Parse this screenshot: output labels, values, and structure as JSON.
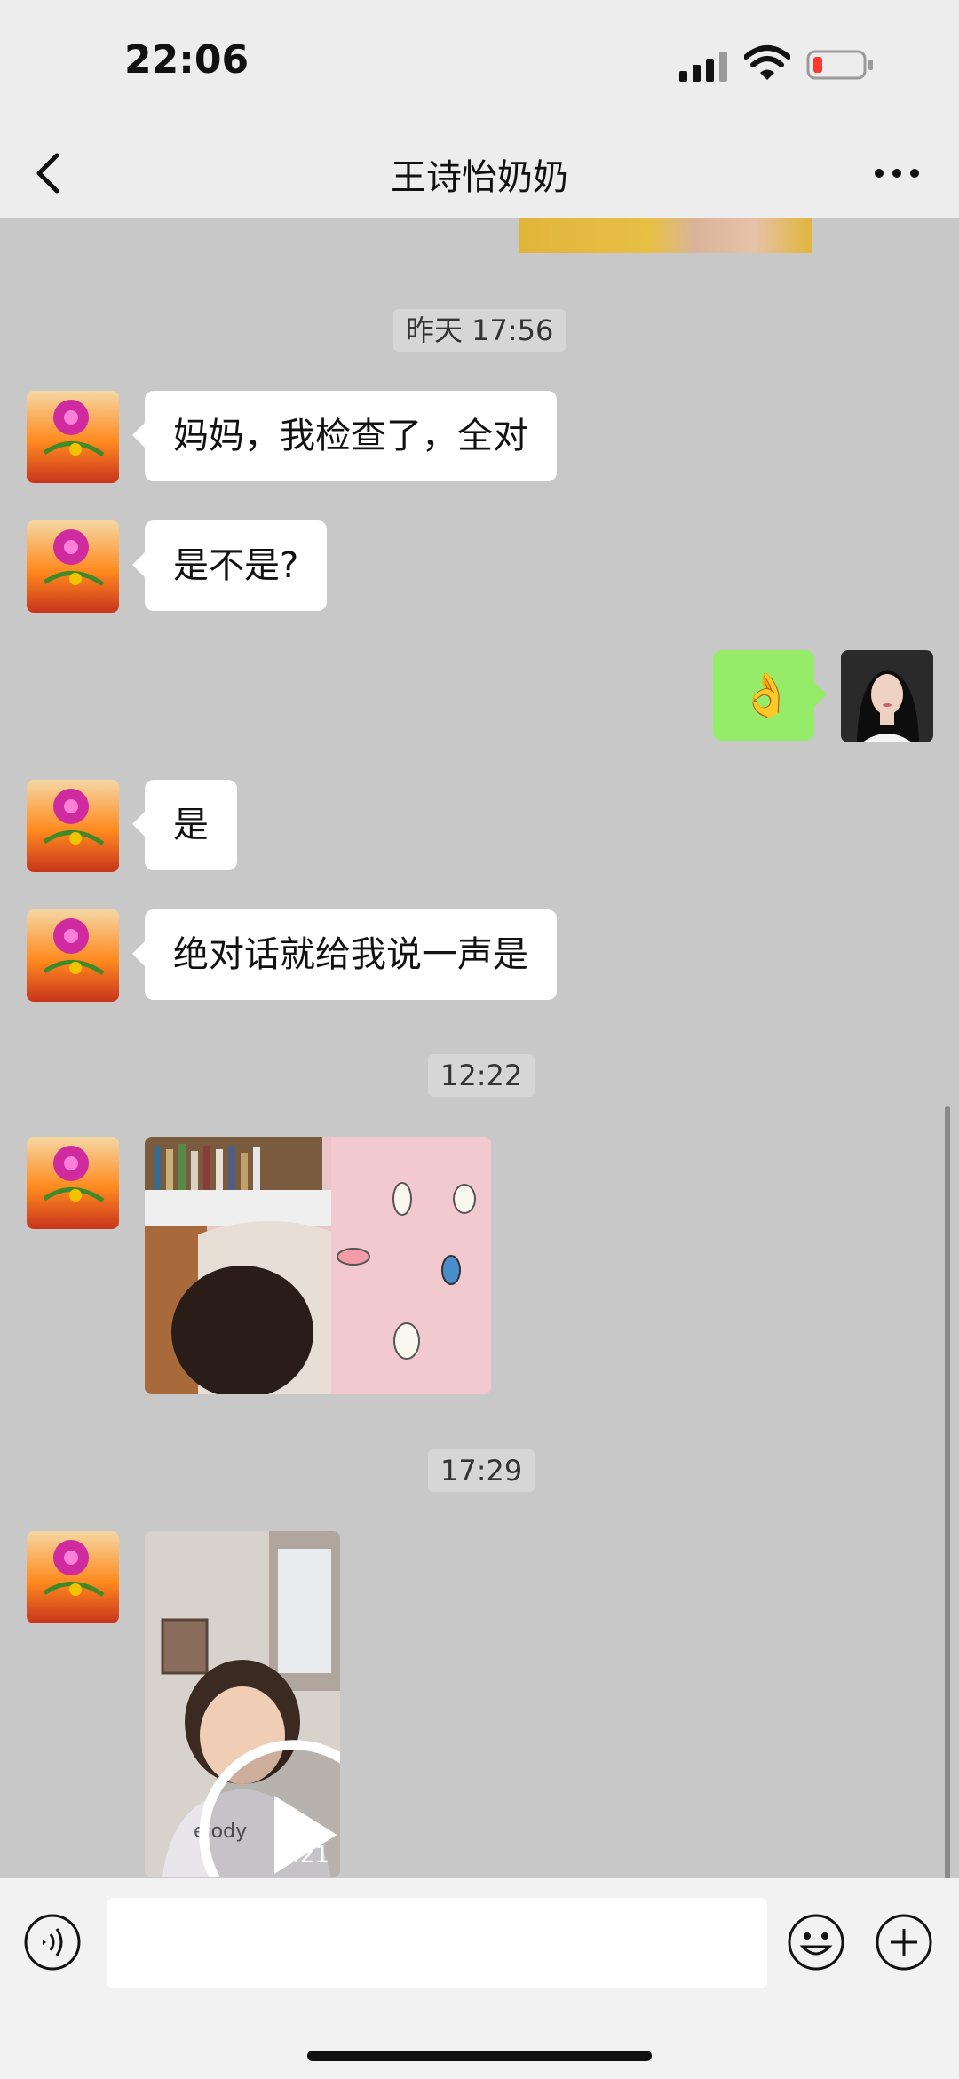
{
  "status_bar": {
    "time": "22:06",
    "signal_icon": "signal-bars-icon",
    "wifi_icon": "wifi-icon",
    "battery_icon": "battery-low-icon",
    "battery_color": "#ff3b30"
  },
  "nav": {
    "back_icon": "chevron-left-icon",
    "title": "王诗怡奶奶",
    "more_icon": "more-dots-icon"
  },
  "chat": {
    "timestamps": [
      "昨天 17:56",
      "12:22",
      "17:29"
    ],
    "messages": [
      {
        "type": "text",
        "side": "left",
        "text": "妈妈，我检查了，全对"
      },
      {
        "type": "text",
        "side": "left",
        "text": "是不是?"
      },
      {
        "type": "emoji",
        "side": "right",
        "text": "👌"
      },
      {
        "type": "text",
        "side": "left",
        "text": "是"
      },
      {
        "type": "text",
        "side": "left",
        "text": "绝对话就给我说一声是"
      },
      {
        "type": "image",
        "side": "left"
      },
      {
        "type": "video",
        "side": "left",
        "duration": "0:21"
      }
    ],
    "bubble_out_color": "#95ec69",
    "bubble_in_color": "#ffffff"
  },
  "input_bar": {
    "voice_icon": "voice-icon",
    "emoji_icon": "smiley-icon",
    "plus_icon": "plus-circle-icon",
    "placeholder": ""
  }
}
